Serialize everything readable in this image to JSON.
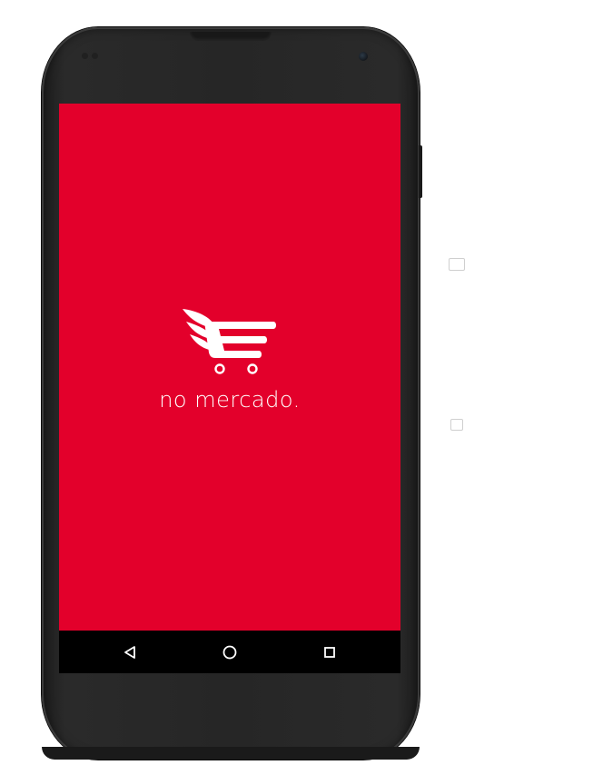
{
  "app": {
    "brand_name": "no mercado.",
    "background_color": "#e3002b",
    "logo_icon": "winged-shopping-cart-icon"
  },
  "navbar": {
    "background_color": "#000000",
    "buttons": [
      {
        "name": "back",
        "icon": "triangle-back-icon"
      },
      {
        "name": "home",
        "icon": "circle-home-icon"
      },
      {
        "name": "recents",
        "icon": "square-recents-icon"
      }
    ]
  },
  "device": {
    "model_frame_color": "#262626"
  },
  "side_icons": [
    {
      "icon": "screenshot-icon"
    },
    {
      "icon": "rotate-icon"
    }
  ]
}
